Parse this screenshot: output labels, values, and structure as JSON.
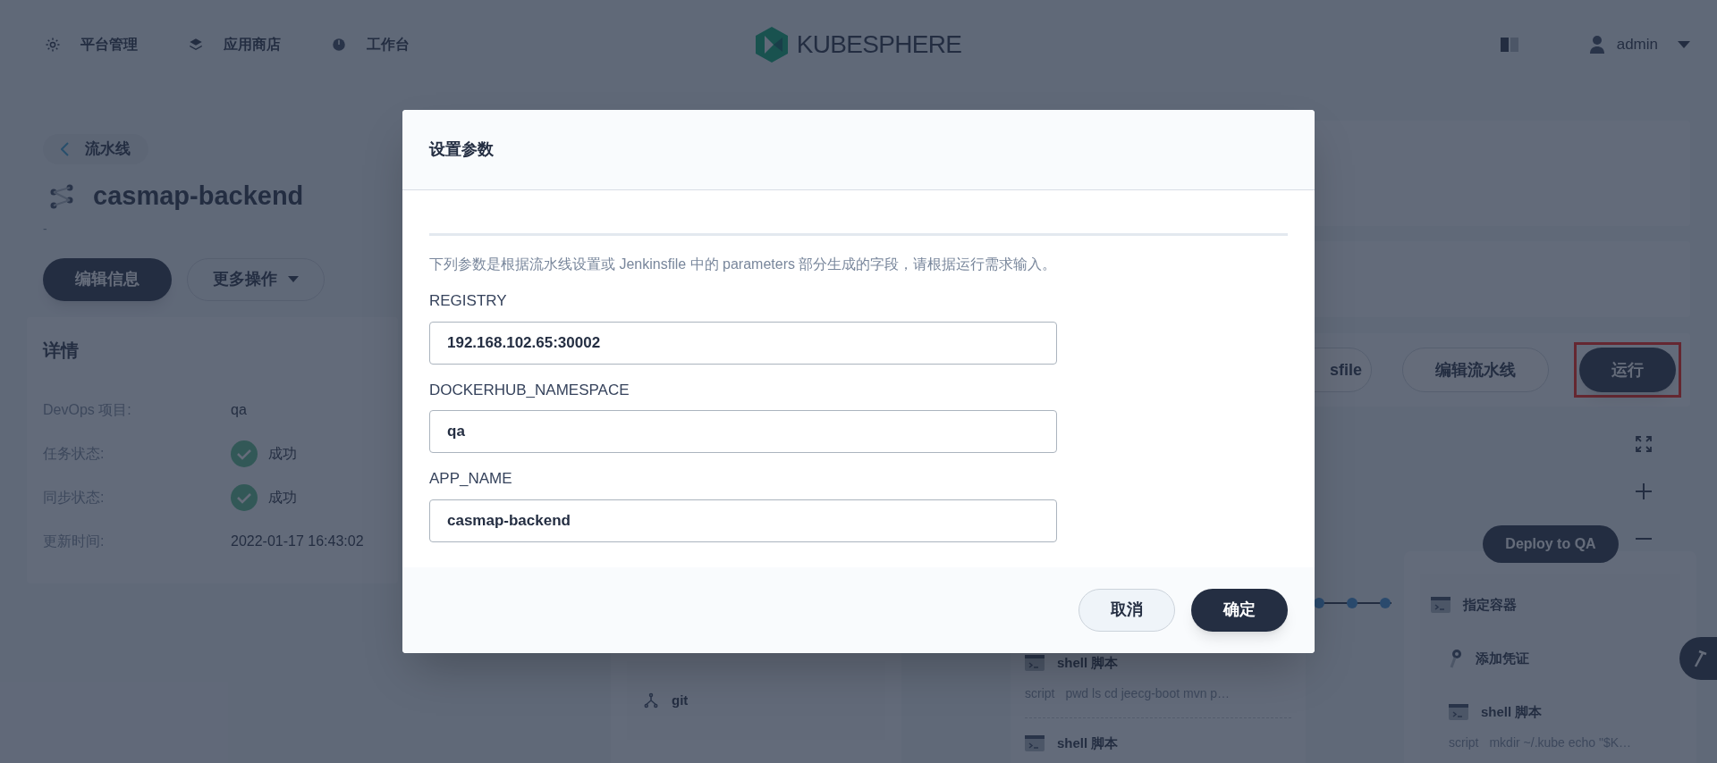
{
  "top_nav": {
    "items": [
      {
        "label": "平台管理",
        "kind": "gear"
      },
      {
        "label": "应用商店",
        "kind": "stack"
      },
      {
        "label": "工作台",
        "kind": "dial"
      }
    ],
    "logo": "KUBESPHERE",
    "user": "admin"
  },
  "pipeline": {
    "back_link": "流水线",
    "name": "casmap-backend",
    "description": "-",
    "actions": [
      {
        "label": "编辑信息",
        "kind": "primary"
      },
      {
        "label": "更多操作",
        "kind": "dropdown"
      }
    ]
  },
  "details": {
    "title": "详情",
    "rows": [
      {
        "label": "DevOps 项目:",
        "value": "qa",
        "kind": "text"
      },
      {
        "label": "任务状态:",
        "value": "成功",
        "kind": "status"
      },
      {
        "label": "同步状态:",
        "value": "成功",
        "kind": "status"
      },
      {
        "label": "更新时间:",
        "value": "2022-01-17 16:43:02",
        "kind": "text"
      }
    ]
  },
  "toolbar": {
    "buttons": [
      {
        "label": "sfile",
        "kind": "outline",
        "highlighted": false
      },
      {
        "label": "编辑流水线",
        "kind": "outline",
        "highlighted": false
      },
      {
        "label": "运行",
        "kind": "primary",
        "highlighted": true
      }
    ]
  },
  "stages": [
    {
      "steps": [
        {
          "kind": "git",
          "title": "git"
        }
      ]
    },
    {
      "steps": [
        {
          "kind": "shell",
          "title": "shell 脚本",
          "script_label": "script",
          "script": "pwd ls cd jeecg-boot mvn p…"
        },
        {
          "kind": "shell",
          "title": "shell 脚本"
        }
      ]
    },
    {
      "name": "Deploy to QA",
      "steps": [
        {
          "kind": "container",
          "title": "指定容器"
        },
        {
          "kind": "credential",
          "title": "添加凭证"
        },
        {
          "kind": "shell",
          "title": "shell 脚本",
          "script_label": "script",
          "script": "mkdir ~/.kube echo \"$K…"
        }
      ]
    }
  ],
  "modal": {
    "title": "设置参数",
    "description": "下列参数是根据流水线设置或 Jenkinsfile 中的 parameters 部分生成的字段，请根据运行需求输入。",
    "params": [
      {
        "name": "REGISTRY",
        "value": "192.168.102.65:30002"
      },
      {
        "name": "DOCKERHUB_NAMESPACE",
        "value": "qa"
      },
      {
        "name": "APP_NAME",
        "value": "casmap-backend"
      }
    ],
    "buttons": [
      {
        "label": "取消",
        "kind": "secondary"
      },
      {
        "label": "确定",
        "kind": "primary"
      }
    ]
  }
}
